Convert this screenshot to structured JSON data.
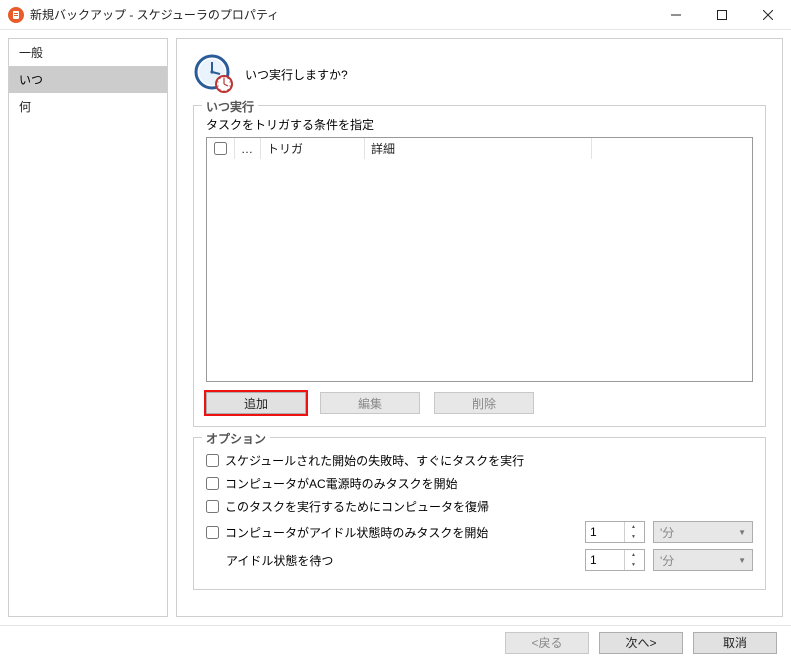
{
  "window": {
    "title": "新規バックアップ - スケジューラのプロパティ"
  },
  "sidebar": {
    "items": [
      {
        "label": "一般"
      },
      {
        "label": "いつ"
      },
      {
        "label": "何"
      }
    ],
    "selected_index": 1
  },
  "header": {
    "question": "いつ実行しますか?"
  },
  "run_when": {
    "title": "いつ実行",
    "caption": "タスクをトリガする条件を指定",
    "columns": {
      "dots": "…",
      "trigger": "トリガ",
      "details": "詳細"
    },
    "buttons": {
      "add": "追加",
      "edit": "編集",
      "delete": "削除"
    }
  },
  "options": {
    "title": "オプション",
    "missed": "スケジュールされた開始の失敗時、すぐにタスクを実行",
    "ac_only": "コンピュータがAC電源時のみタスクを開始",
    "wake": "このタスクを実行するためにコンピュータを復帰",
    "idle_only": "コンピュータがアイドル状態時のみタスクを開始",
    "idle_value": "1",
    "idle_unit": "'分",
    "wait_idle": "アイドル状態を待つ",
    "wait_value": "1",
    "wait_unit": "'分"
  },
  "footer": {
    "back": "<戻る",
    "next": "次へ>",
    "cancel": "取消"
  }
}
